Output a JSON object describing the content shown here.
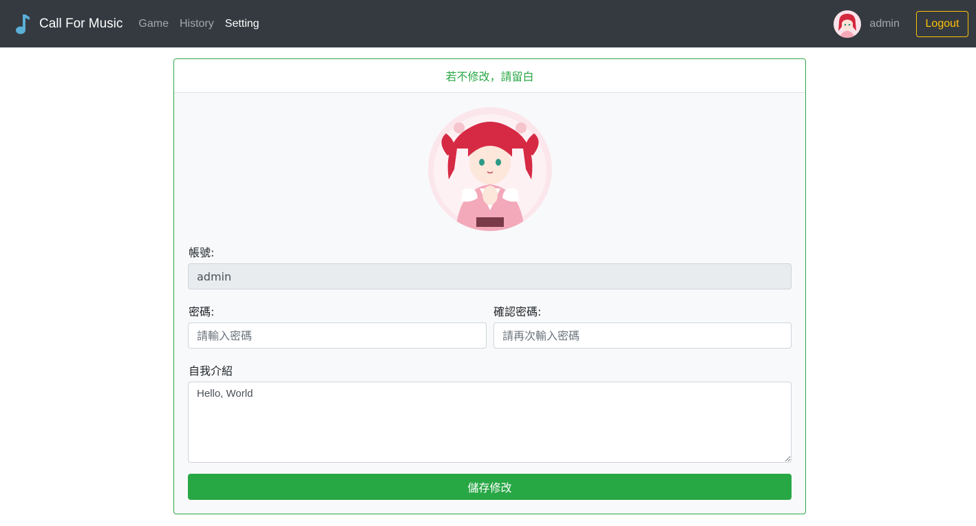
{
  "navbar": {
    "brand": "Call For Music",
    "links": [
      {
        "label": "Game",
        "active": false
      },
      {
        "label": "History",
        "active": false
      },
      {
        "label": "Setting",
        "active": true
      }
    ],
    "username": "admin",
    "logout_label": "Logout"
  },
  "card": {
    "header": "若不修改，請留白",
    "account_label": "帳號:",
    "account_value": "admin",
    "password_label": "密碼:",
    "password_placeholder": "請輸入密碼",
    "confirm_label": "確認密碼:",
    "confirm_placeholder": "請再次輸入密碼",
    "bio_label": "自我介紹",
    "bio_value": "Hello, World",
    "save_label": "儲存修改"
  },
  "colors": {
    "navbar_bg": "#343a40",
    "accent": "#28a745",
    "logout": "#ffc107"
  },
  "icons": {
    "brand": "music-note-icon"
  }
}
